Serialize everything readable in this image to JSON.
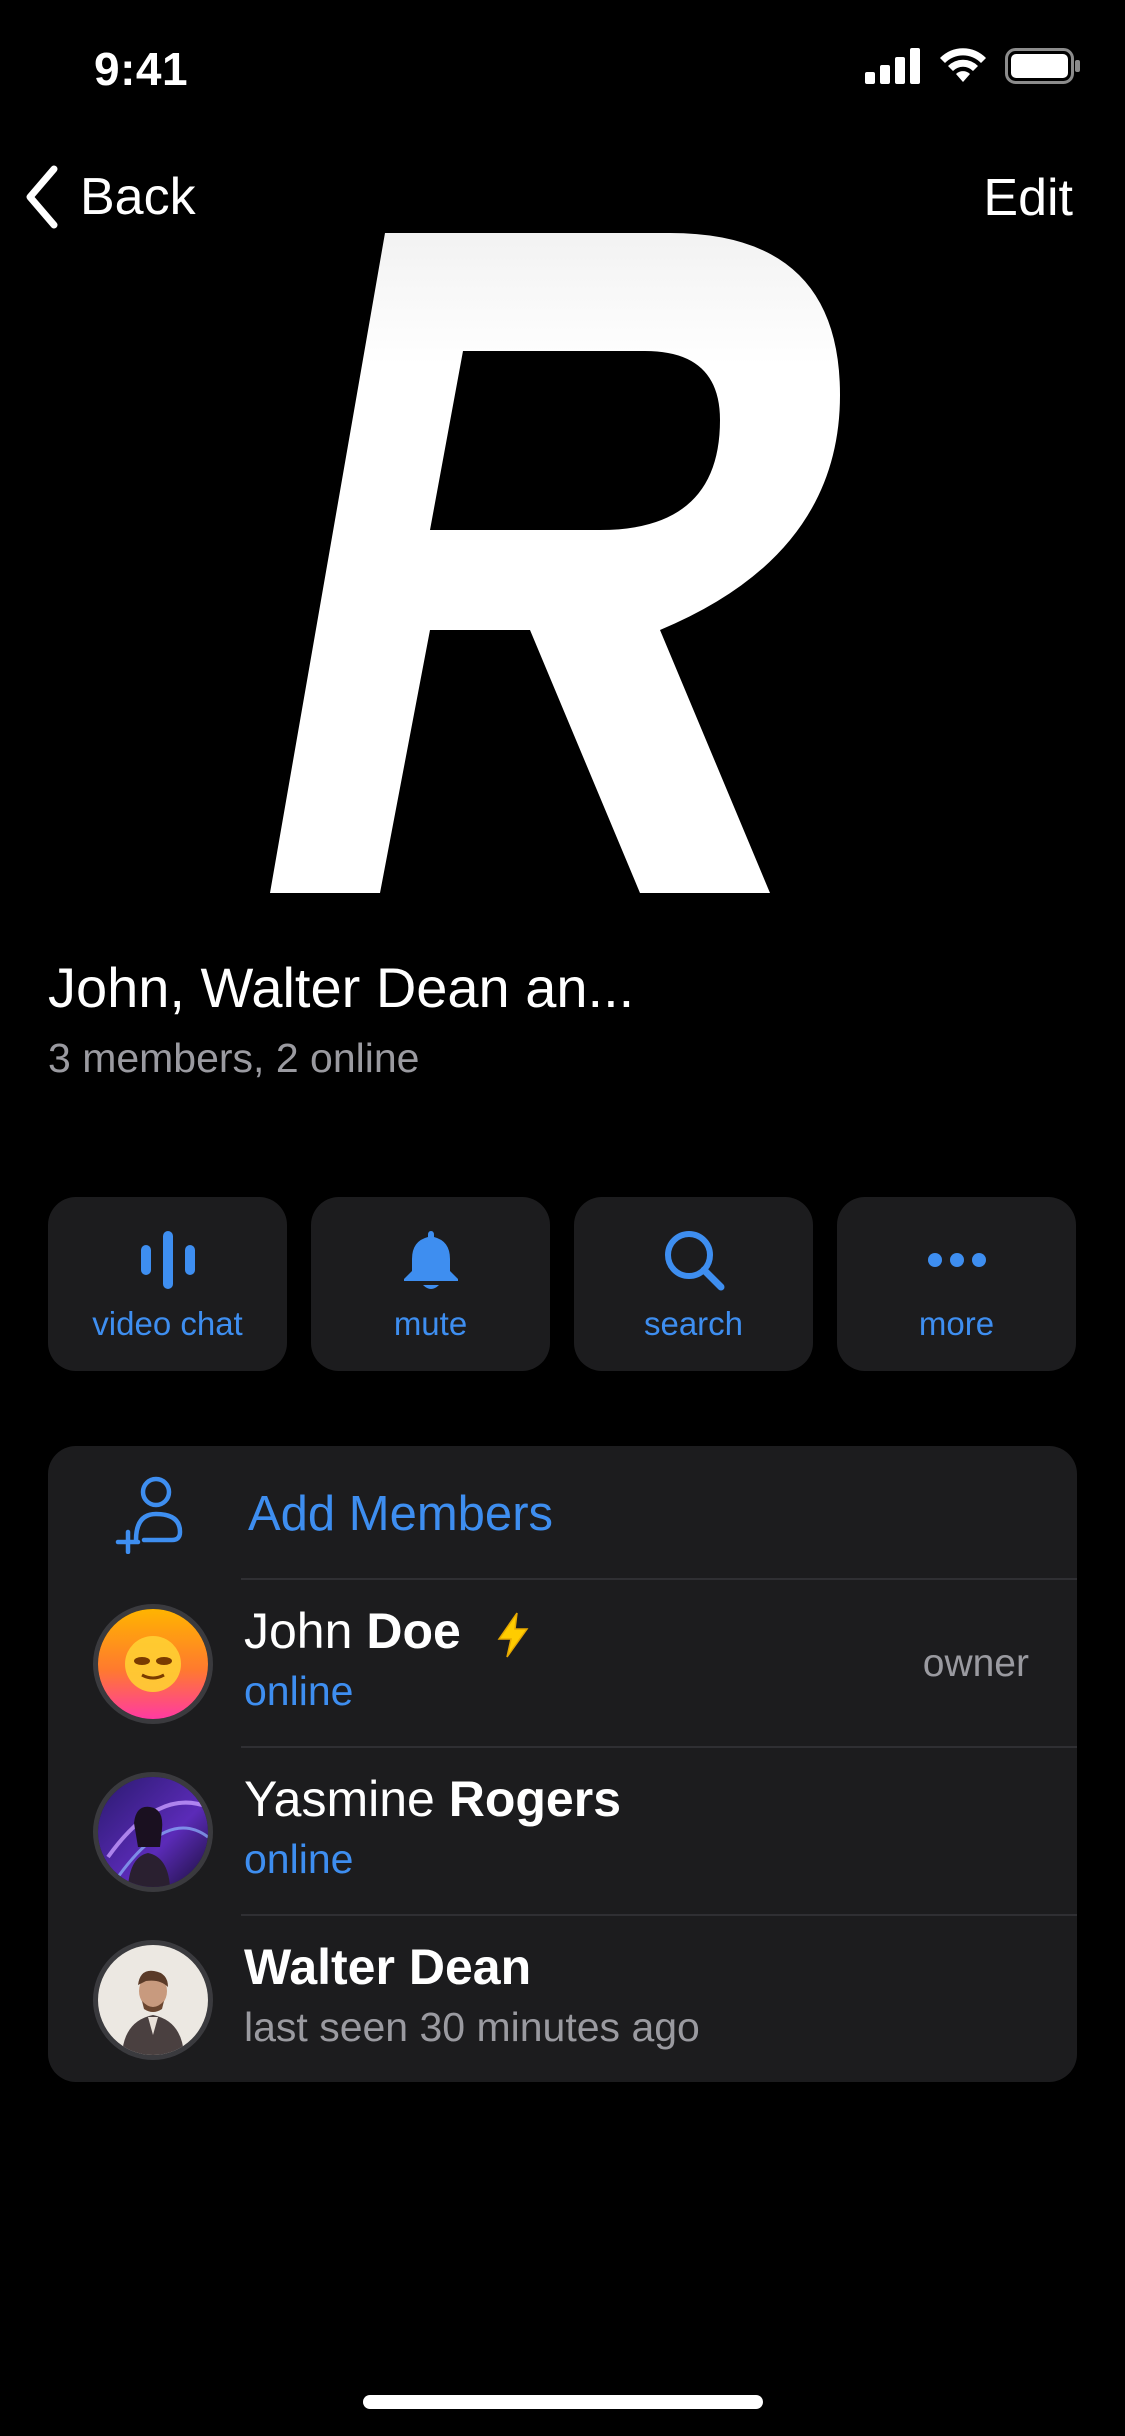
{
  "status_bar": {
    "time": "9:41",
    "icons": [
      "cellular-signal-icon",
      "wifi-icon",
      "battery-icon"
    ]
  },
  "nav": {
    "back_label": "Back",
    "edit_label": "Edit"
  },
  "avatar": {
    "letter": "R"
  },
  "group": {
    "title": "John, Walter Dean an...",
    "subtitle": "3 members, 2 online"
  },
  "actions": [
    {
      "label": "video chat",
      "icon": "voice-chat-icon"
    },
    {
      "label": "mute",
      "icon": "bell-icon"
    },
    {
      "label": "search",
      "icon": "search-icon"
    },
    {
      "label": "more",
      "icon": "more-icon"
    }
  ],
  "members_section": {
    "add_label": "Add Members",
    "members": [
      {
        "first": "John",
        "last": "Doe",
        "status": "online",
        "role": "owner",
        "badge": "lightning-icon"
      },
      {
        "first": "Yasmine",
        "last": "Rogers",
        "status": "online",
        "role": ""
      },
      {
        "first": "Walter",
        "last": "Dean",
        "status": "last seen 30 minutes ago",
        "role": ""
      }
    ]
  },
  "colors": {
    "accent": "#3e8ef0",
    "background": "#000000",
    "card": "#1c1c1e",
    "secondary_text": "#9a9aa0"
  }
}
